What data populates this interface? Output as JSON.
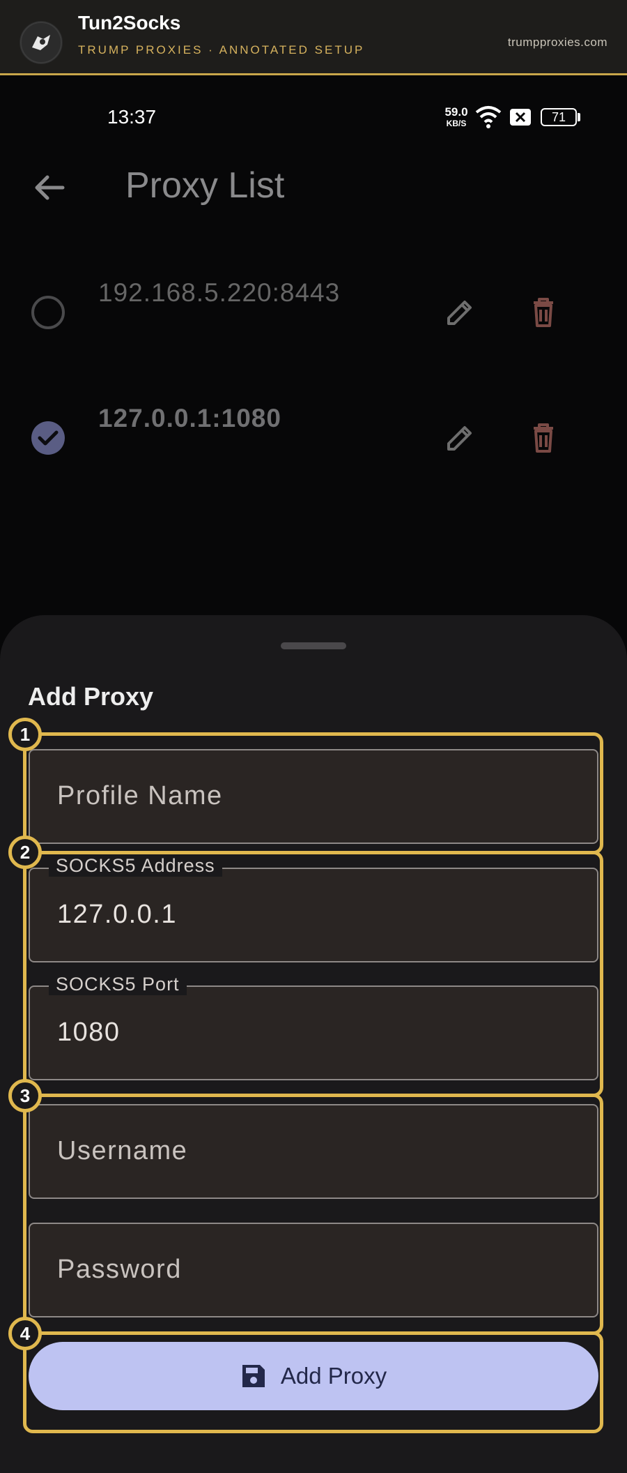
{
  "banner": {
    "app_name": "Tun2Socks",
    "subtitle": "TRUMP PROXIES · ANNOTATED SETUP",
    "domain": "trumpproxies.com"
  },
  "status_bar": {
    "time": "13:37",
    "speed_value": "59.0",
    "speed_unit": "KB/S",
    "battery": "71"
  },
  "topbar": {
    "title": "Proxy List"
  },
  "proxies": [
    {
      "address": "192.168.5.220:8443",
      "selected": false
    },
    {
      "address": "127.0.0.1:1080",
      "selected": true
    }
  ],
  "sheet": {
    "title": "Add Proxy",
    "profile_name_placeholder": "Profile Name",
    "address_label": "SOCKS5 Address",
    "address_value": "127.0.0.1",
    "port_label": "SOCKS5 Port",
    "port_value": "1080",
    "username_placeholder": "Username",
    "password_placeholder": "Password",
    "button_label": "Add Proxy"
  },
  "annotations": [
    "1",
    "2",
    "3",
    "4"
  ],
  "colors": {
    "accent_gold": "#e0b84e",
    "button_bg": "#bec3f2",
    "delete_icon": "#7a4a45"
  }
}
